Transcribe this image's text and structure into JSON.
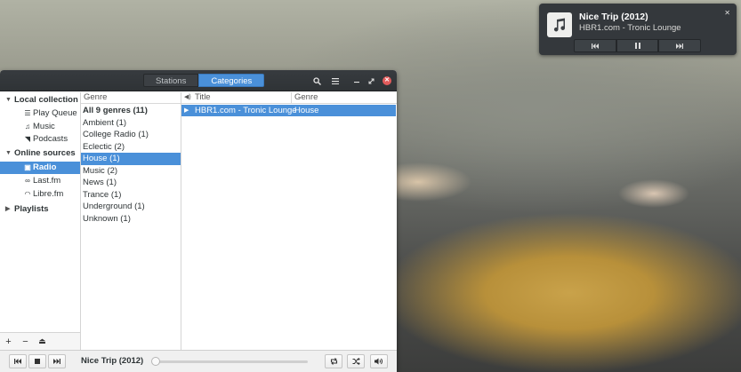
{
  "notification": {
    "title": "Nice Trip (2012)",
    "subtitle": "HBR1.com - Tronic Lounge",
    "close_icon": "close-icon",
    "buttons": [
      "previous-icon",
      "pause-icon",
      "next-icon"
    ]
  },
  "header": {
    "tabs": [
      {
        "label": "Stations",
        "active": false
      },
      {
        "label": "Categories",
        "active": true
      }
    ],
    "icons": [
      "search-icon",
      "menu-icon",
      "minimize-icon",
      "maximize-icon",
      "close-icon"
    ]
  },
  "sidebar": {
    "local_collection": "Local collection",
    "play_queue": "Play Queue",
    "music": "Music",
    "podcasts": "Podcasts",
    "online_sources": "Online sources",
    "radio": "Radio",
    "lastfm": "Last.fm",
    "librefm": "Libre.fm",
    "playlists": "Playlists",
    "toolbar": [
      "+",
      "−",
      "⏏"
    ]
  },
  "genres": {
    "header": "Genre",
    "items": [
      "All 9 genres (11)",
      "Ambient (1)",
      "College Radio (1)",
      "Eclectic (2)",
      "House (1)",
      "Music (2)",
      "News (1)",
      "Trance (1)",
      "Underground (1)",
      "Unknown (1)"
    ],
    "selected_index": 4
  },
  "stations": {
    "col_title": "Title",
    "col_genre": "Genre",
    "rows": [
      {
        "title": "HBR1.com - Tronic Lounge",
        "genre": "House"
      }
    ]
  },
  "player": {
    "now_playing": "Nice Trip (2012)",
    "progress": 0.0
  },
  "colors": {
    "accent": "#4a90d9",
    "header_bg": "#34383c",
    "close": "#e25c5c"
  }
}
